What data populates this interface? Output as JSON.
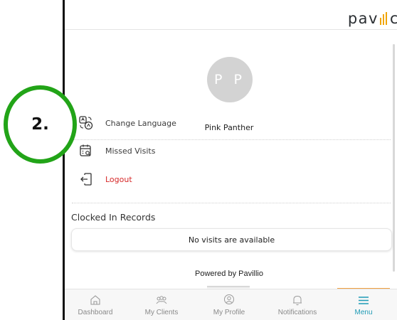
{
  "app": {
    "logo_text": "pavillio"
  },
  "profile": {
    "initials": "P P",
    "name": "Pink Panther"
  },
  "menu": {
    "items": [
      {
        "label": "Change Language",
        "icon": "language-icon"
      },
      {
        "label": "Missed Visits",
        "icon": "calendar-search-icon"
      },
      {
        "label": "Logout",
        "icon": "logout-icon",
        "color": "#d62828"
      }
    ]
  },
  "records": {
    "title": "Clocked In Records",
    "empty_message": "No visits are available"
  },
  "footer": {
    "powered_by": "Powered by Pavillio"
  },
  "bottom_nav": {
    "items": [
      {
        "label": "Dashboard",
        "icon": "home-icon"
      },
      {
        "label": "My Clients",
        "icon": "clients-icon"
      },
      {
        "label": "My Profile",
        "icon": "profile-icon"
      },
      {
        "label": "Notifications",
        "icon": "bell-icon"
      },
      {
        "label": "Menu",
        "icon": "hamburger-icon",
        "active": true
      }
    ]
  },
  "annotation": {
    "step": "2."
  },
  "colors": {
    "accent": "#1f9bb5",
    "logout": "#d62828",
    "logo_bars": "#f0a500",
    "annotation_ring": "#22a418"
  }
}
